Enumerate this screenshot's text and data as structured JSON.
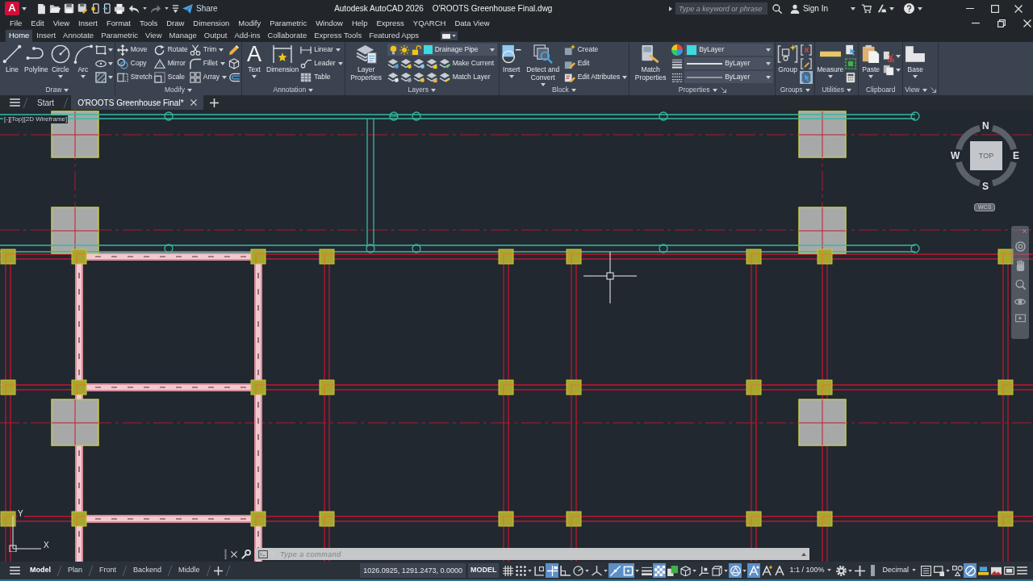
{
  "title_bar": {
    "logo": "A",
    "share": "Share",
    "app_title": "Autodesk AutoCAD 2026",
    "document_title": "O'ROOTS Greenhouse Final.dwg",
    "search": {
      "placeholder": "Type a keyword or phrase"
    },
    "sign_in": "Sign In"
  },
  "menu_bar": [
    "File",
    "Edit",
    "View",
    "Insert",
    "Format",
    "Tools",
    "Draw",
    "Dimension",
    "Modify",
    "Parametric",
    "Window",
    "Help",
    "Express",
    "YQARCH",
    "Data View"
  ],
  "ribbon_tabs": [
    {
      "label": "Home",
      "selected": true
    },
    {
      "label": "Insert",
      "selected": false
    },
    {
      "label": "Annotate",
      "selected": false
    },
    {
      "label": "Parametric",
      "selected": false
    },
    {
      "label": "View",
      "selected": false
    },
    {
      "label": "Manage",
      "selected": false
    },
    {
      "label": "Output",
      "selected": false
    },
    {
      "label": "Add-ins",
      "selected": false
    },
    {
      "label": "Collaborate",
      "selected": false
    },
    {
      "label": "Express Tools",
      "selected": false
    },
    {
      "label": "Featured Apps",
      "selected": false
    }
  ],
  "ribbon_panels": [
    {
      "title": "Draw",
      "menu": true,
      "launcher": false,
      "columns": [
        [
          [
            {
              "kind": "large",
              "label": "Line",
              "menu": false
            }
          ]
        ],
        [
          [
            {
              "kind": "large",
              "label": "Polyline",
              "menu": false
            }
          ]
        ],
        [
          [
            {
              "kind": "large",
              "label": "Circle",
              "menu": true
            }
          ]
        ],
        [
          [
            {
              "kind": "large",
              "label": "Arc",
              "menu": true
            }
          ]
        ],
        [
          [
            {
              "kind": "icon",
              "menu": true
            }
          ],
          [
            {
              "kind": "icon",
              "menu": true
            }
          ],
          [
            {
              "kind": "icon",
              "menu": true
            }
          ]
        ]
      ]
    },
    {
      "title": "Modify",
      "menu": true,
      "launcher": false,
      "columns": [
        [
          [
            {
              "kind": "small",
              "label": "Move",
              "menu": false
            }
          ],
          [
            {
              "kind": "small",
              "label": "Copy",
              "menu": false
            }
          ],
          [
            {
              "kind": "small",
              "label": "Stretch",
              "menu": false
            }
          ]
        ],
        [
          [
            {
              "kind": "small",
              "label": "Rotate",
              "menu": false
            }
          ],
          [
            {
              "kind": "small",
              "label": "Mirror",
              "menu": false
            }
          ],
          [
            {
              "kind": "small",
              "label": "Scale",
              "menu": false
            }
          ]
        ],
        [
          [
            {
              "kind": "small",
              "label": "Trim",
              "menu": true
            }
          ],
          [
            {
              "kind": "small",
              "label": "Fillet",
              "menu": true
            }
          ],
          [
            {
              "kind": "small",
              "label": "Array",
              "menu": true
            }
          ]
        ],
        [
          [
            {
              "kind": "icon",
              "menu": false
            }
          ],
          [
            {
              "kind": "icon",
              "menu": false
            }
          ],
          [
            {
              "kind": "icon",
              "menu": false
            }
          ]
        ]
      ]
    },
    {
      "title": "Annotation",
      "menu": true,
      "launcher": false,
      "columns": [
        [
          [
            {
              "kind": "large",
              "label": "Text",
              "glyph": "A",
              "menu": true
            }
          ]
        ],
        [
          [
            {
              "kind": "large",
              "label": "Dimension",
              "menu": false
            }
          ]
        ],
        [
          [
            {
              "kind": "small",
              "label": "Linear",
              "menu": true
            }
          ],
          [
            {
              "kind": "small",
              "label": "Leader",
              "menu": true
            }
          ],
          [
            {
              "kind": "small",
              "label": "Table",
              "menu": false
            }
          ]
        ]
      ]
    },
    {
      "title": "Layers",
      "menu": true,
      "launcher": false,
      "columns": [
        [
          [
            {
              "kind": "large",
              "label": "Layer Properties",
              "menu": false
            }
          ]
        ],
        [
          [
            {
              "kind": "layer",
              "value": "Drainage Pipe"
            }
          ],
          [
            {
              "kind": "icon",
              "menu": false
            },
            {
              "kind": "icon",
              "menu": false
            },
            {
              "kind": "icon",
              "menu": false
            },
            {
              "kind": "icon",
              "menu": false
            },
            {
              "kind": "small",
              "label": "Make Current",
              "menu": false
            }
          ],
          [
            {
              "kind": "icon",
              "menu": false
            },
            {
              "kind": "icon",
              "menu": false
            },
            {
              "kind": "icon",
              "menu": false
            },
            {
              "kind": "icon",
              "menu": false
            },
            {
              "kind": "small",
              "label": "Match Layer",
              "menu": false
            }
          ]
        ]
      ]
    },
    {
      "title": "Block",
      "menu": true,
      "launcher": false,
      "columns": [
        [
          [
            {
              "kind": "large",
              "label": "Insert",
              "menu": true
            }
          ]
        ],
        [
          [
            {
              "kind": "large",
              "label": "Detect and Convert",
              "menu": true
            }
          ]
        ],
        [
          [
            {
              "kind": "small",
              "label": "Create",
              "menu": false
            }
          ],
          [
            {
              "kind": "small",
              "label": "Edit",
              "menu": false
            }
          ],
          [
            {
              "kind": "small",
              "label": "Edit Attributes",
              "menu": true
            }
          ]
        ]
      ]
    },
    {
      "title": "Properties",
      "menu": true,
      "launcher": true,
      "columns": [
        [
          [
            {
              "kind": "large",
              "label": "Match Properties",
              "menu": false
            }
          ]
        ],
        [
          [
            {
              "kind": "icon",
              "menu": false
            },
            {
              "kind": "swatch",
              "value": "ByLayer"
            }
          ],
          [
            {
              "kind": "icon",
              "menu": false
            },
            {
              "kind": "lineweight",
              "value": "ByLayer"
            }
          ],
          [
            {
              "kind": "icon",
              "menu": false
            },
            {
              "kind": "linetype",
              "value": "ByLayer"
            }
          ]
        ]
      ]
    },
    {
      "title": "Groups",
      "menu": true,
      "launcher": false,
      "columns": [
        [
          [
            {
              "kind": "large",
              "label": "Group",
              "menu": false
            }
          ]
        ],
        [
          [
            {
              "kind": "icon",
              "menu": false,
              "on": false
            }
          ],
          [
            {
              "kind": "icon",
              "menu": false,
              "on": false
            }
          ],
          [
            {
              "kind": "icon",
              "menu": false,
              "on": true
            }
          ]
        ]
      ]
    },
    {
      "title": "Utilities",
      "menu": true,
      "launcher": false,
      "columns": [
        [
          [
            {
              "kind": "large",
              "label": "Measure",
              "menu": true
            }
          ]
        ],
        [
          [
            {
              "kind": "icon",
              "menu": false
            }
          ],
          [
            {
              "kind": "icon",
              "menu": false
            }
          ],
          [
            {
              "kind": "icon",
              "menu": false
            }
          ]
        ]
      ]
    },
    {
      "title": "Clipboard",
      "menu": false,
      "launcher": false,
      "columns": [
        [
          [
            {
              "kind": "large",
              "label": "Paste",
              "menu": true
            }
          ]
        ],
        [
          [
            {
              "kind": "icon",
              "menu": true
            }
          ],
          [
            {
              "kind": "icon",
              "menu": true
            }
          ]
        ]
      ]
    },
    {
      "title": "View",
      "menu": true,
      "launcher": true,
      "columns": [
        [
          [
            {
              "kind": "large",
              "label": "Base",
              "menu": true
            }
          ]
        ]
      ]
    }
  ],
  "file_tabs": [
    {
      "label": "Start",
      "selected": false
    },
    {
      "label": "O'ROOTS Greenhouse Final*",
      "selected": true
    }
  ],
  "viewport_controls": [
    "[-]",
    "[Top]",
    "[2D Wireframe]"
  ],
  "view_cube": {
    "north": "N",
    "west": "W",
    "east": "E",
    "south": "S",
    "face": "TOP",
    "ucs_menu": "WCS"
  },
  "ucs_icon": {
    "x_axis": "X",
    "y_axis": "Y"
  },
  "command_line": {
    "placeholder": "Type a command"
  },
  "status_bar": {
    "tabs": [
      {
        "label": "Model",
        "selected": true
      },
      {
        "label": "Plan",
        "selected": false
      },
      {
        "label": "Front",
        "selected": false
      },
      {
        "label": "Backend",
        "selected": false
      },
      {
        "label": "Middle",
        "selected": false
      }
    ],
    "coordinates": "1026.0925, 1291.2473, 0.0000",
    "space": "MODEL",
    "tools": [
      {
        "kind": "toggle",
        "on": false,
        "menu": false
      },
      {
        "kind": "toggle",
        "on": false,
        "menu": true
      },
      {
        "kind": "toggle",
        "on": false,
        "menu": false
      },
      {
        "kind": "toggle",
        "on": true,
        "menu": false
      },
      {
        "kind": "toggle",
        "on": false,
        "menu": false
      },
      {
        "kind": "toggle",
        "on": false,
        "menu": true
      },
      {
        "kind": "toggle",
        "on": false,
        "menu": true
      },
      {
        "kind": "toggle",
        "on": true,
        "menu": false
      },
      {
        "kind": "toggle",
        "on": true,
        "menu": true
      },
      {
        "kind": "toggle",
        "on": false,
        "menu": false
      },
      {
        "kind": "toggle",
        "on": true,
        "menu": false
      },
      {
        "kind": "toggle",
        "on": false,
        "menu": false
      },
      {
        "kind": "toggle",
        "on": false,
        "menu": true
      },
      {
        "kind": "toggle",
        "on": false,
        "menu": false
      },
      {
        "kind": "toggle",
        "on": false,
        "menu": true
      },
      {
        "kind": "toggle",
        "on": true,
        "menu": true
      },
      {
        "kind": "toggle",
        "on": true,
        "menu": false
      },
      {
        "kind": "toggle",
        "on": false,
        "menu": false
      },
      {
        "kind": "toggle",
        "on": false,
        "menu": false
      },
      {
        "kind": "text",
        "label": "1:1 / 100%",
        "menu": true
      },
      {
        "kind": "toggle",
        "on": false,
        "menu": true
      },
      {
        "kind": "toggle",
        "on": false,
        "menu": false
      },
      {
        "kind": "toggle",
        "on": false,
        "menu": false
      },
      {
        "kind": "text",
        "label": "Decimal",
        "menu": true
      },
      {
        "kind": "toggle",
        "on": false,
        "menu": false
      },
      {
        "kind": "toggle",
        "on": false,
        "menu": true
      },
      {
        "kind": "toggle",
        "on": false,
        "menu": false
      },
      {
        "kind": "toggle",
        "on": true,
        "menu": false
      },
      {
        "kind": "toggle",
        "on": false,
        "menu": false
      },
      {
        "kind": "toggle",
        "on": false,
        "menu": false
      },
      {
        "kind": "toggle",
        "on": false,
        "menu": false
      },
      {
        "kind": "toggle",
        "on": false,
        "menu": false
      }
    ]
  }
}
